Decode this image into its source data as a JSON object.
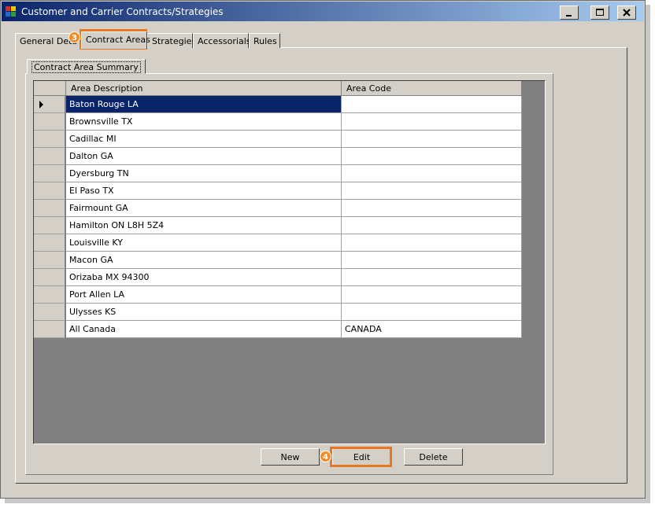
{
  "window": {
    "title": "Customer and Carrier Contracts/Strategies"
  },
  "tabs": [
    {
      "label": "General Deta"
    },
    {
      "label": "Contract Areas"
    },
    {
      "label": "Strategies"
    },
    {
      "label": "Accessorials"
    },
    {
      "label": "Rules"
    }
  ],
  "group": {
    "label": "Contract Area Summary"
  },
  "grid": {
    "columns": [
      "Area Description",
      "Area Code"
    ],
    "rows": [
      {
        "description": "Baton Rouge LA",
        "code": ""
      },
      {
        "description": "Brownsville TX",
        "code": ""
      },
      {
        "description": "Cadillac MI",
        "code": ""
      },
      {
        "description": "Dalton GA",
        "code": ""
      },
      {
        "description": "Dyersburg TN",
        "code": ""
      },
      {
        "description": "El Paso TX",
        "code": ""
      },
      {
        "description": "Fairmount GA",
        "code": ""
      },
      {
        "description": "Hamilton ON L8H 5Z4",
        "code": ""
      },
      {
        "description": "Louisville KY",
        "code": ""
      },
      {
        "description": "Macon GA",
        "code": ""
      },
      {
        "description": "Orizaba MX 94300",
        "code": ""
      },
      {
        "description": "Port Allen LA",
        "code": ""
      },
      {
        "description": "Ulysses KS",
        "code": ""
      },
      {
        "description": "All Canada",
        "code": "CANADA"
      }
    ]
  },
  "buttons": {
    "new": "New",
    "edit": "Edit",
    "delete": "Delete"
  },
  "callouts": {
    "tab_step": "3",
    "edit_step": "4"
  },
  "colors": {
    "highlight": "#e87722",
    "selection": "#0a246a",
    "titlebar": "#0a246a"
  }
}
